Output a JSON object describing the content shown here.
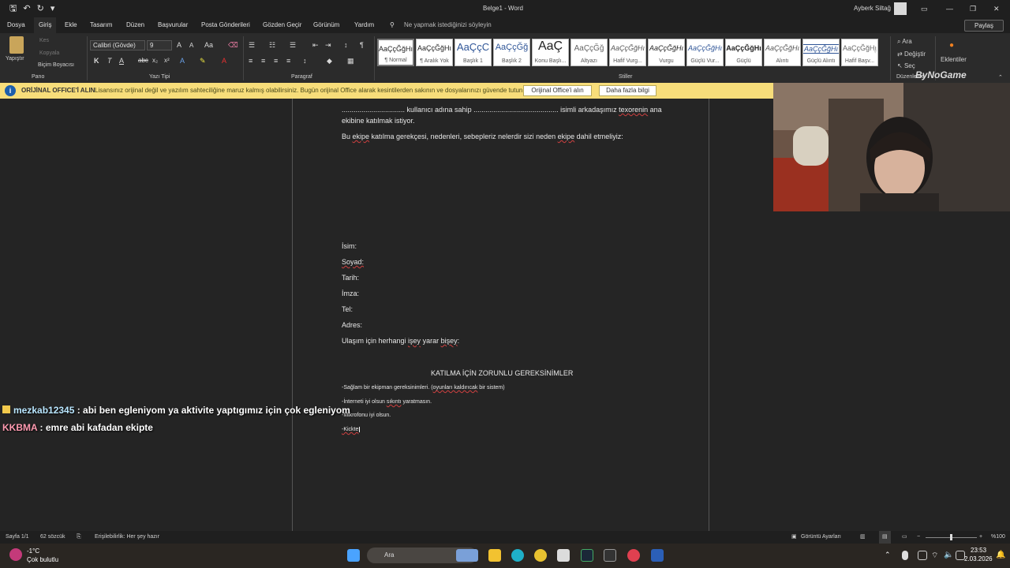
{
  "titlebar": {
    "document_title": "Belge1  -  Word",
    "user_name": "Ayberk Siltağ"
  },
  "tabs": [
    "Dosya",
    "Giriş",
    "Ekle",
    "Tasarım",
    "Düzen",
    "Başvurular",
    "Posta Gönderileri",
    "Gözden Geçir",
    "Görünüm",
    "Yardım"
  ],
  "tell_me": "Ne yapmak istediğinizi söyleyin",
  "share_label": "Paylaş",
  "ribbon": {
    "clipboard": {
      "paste": "Yapıştır",
      "cut": "Kes",
      "copy": "Kopyala",
      "format_painter": "Biçim Boyacısı",
      "group": "Pano"
    },
    "font": {
      "name": "Calibri (Gövde)",
      "size": "9",
      "group": "Yazı Tipi"
    },
    "paragraph": {
      "group": "Paragraf"
    },
    "styles": {
      "group": "Stiller",
      "items": [
        {
          "sample": "AaÇçĞğHı",
          "name": "¶ Normal"
        },
        {
          "sample": "AaÇçĞğHı",
          "name": "¶ Aralık Yok"
        },
        {
          "sample": "AaÇçC",
          "name": "Başlık 1"
        },
        {
          "sample": "AaÇçĞğ",
          "name": "Başlık 2"
        },
        {
          "sample": "AaÇ",
          "name": "Konu Başlı..."
        },
        {
          "sample": "AaÇçĞğ",
          "name": "Altyazı"
        },
        {
          "sample": "AaÇçĞğHı",
          "name": "Hafif Vurg..."
        },
        {
          "sample": "AaÇçĞğHı",
          "name": "Vurgu"
        },
        {
          "sample": "AaÇçĞğHı",
          "name": "Güçlü Vur..."
        },
        {
          "sample": "AaÇçĞğHı",
          "name": "Güçlü"
        },
        {
          "sample": "AaÇçĞğHı",
          "name": "Alıntı"
        },
        {
          "sample": "AaÇçĞğHı",
          "name": "Güçlü Alıntı"
        },
        {
          "sample": "AaÇçĞğHı",
          "name": "Hafif Başv..."
        }
      ]
    },
    "editing": {
      "find": "Ara",
      "replace": "Değiştir",
      "select": "Seç",
      "group": "Düzenleme"
    },
    "addins": {
      "label": "Eklentiler"
    },
    "watermark": "ByNoGame"
  },
  "infobar": {
    "heading": "ORİJİNAL OFFICE'İ ALIN",
    "message": "Lisansınız orijinal değil ve yazılım sahteciliğine maruz kalmış olabilirsiniz. Bugün orijinal Office alarak kesintilerden sakının ve dosyalarınızı güvende tutun.",
    "btn_primary": "Orijinal Office'i alın",
    "btn_more": "Daha fazla bilgi"
  },
  "document": {
    "line1_a": "................................ kullanıcı adına sahip ........................................... isimli arkadaşımız ",
    "line1_b": "texorenin",
    "line1_c": " ana",
    "line2": "ekibine katılmak istiyor.",
    "q_a": "Bu ",
    "q_b": "ekipe",
    "q_c": " katılma gerekçesi, nedenleri, sebepleriz nelerdir sizi neden ",
    "q_d": "ekipe",
    "q_e": " dahil etmeliyiz:",
    "fields": [
      "İsim:",
      "Soyad:",
      "Tarih:",
      "İmza:",
      "Tel:",
      "Adres:"
    ],
    "contact_a": "Ulaşım için herhangi ",
    "contact_b": "işey",
    "contact_c": " yarar ",
    "contact_d": "bişey",
    "contact_e": ":",
    "req_title": "KATILMA İÇİN ZORUNLU GEREKSİNİMLER",
    "req1_a": "-Sağlam bir ekipman gereksinimleri. (",
    "req1_b": "oyunları kaldırıcak",
    "req1_c": " bir sistem)",
    "req2_a": "-İnterneti iyi olsun ",
    "req2_b": "sıkıntı",
    "req2_c": " yaratmasın.",
    "req3": "-Mikrofonu iyi olsun.",
    "req4": "-Kickte"
  },
  "chat": [
    {
      "user": "mezkab12345",
      "text": " : abi ben egleniyom ya aktivite yaptıgımız için çok egleniyom",
      "color": "#b9e6ff"
    },
    {
      "user": "KKBMA",
      "text": " : emre abi kafadan ekipte",
      "color": "#ff9ab0"
    }
  ],
  "statusbar": {
    "page": "Sayfa 1/1",
    "words": "62 sözcük",
    "accessibility": "Erişilebilirlik: Her şey hazır",
    "display_settings": "Görüntü Ayarları",
    "zoom": "%100"
  },
  "taskbar": {
    "temp": "-1°C",
    "weather": "Çok bulutlu",
    "search": "Ara",
    "time": "23:53",
    "date": "2.03.2026"
  }
}
